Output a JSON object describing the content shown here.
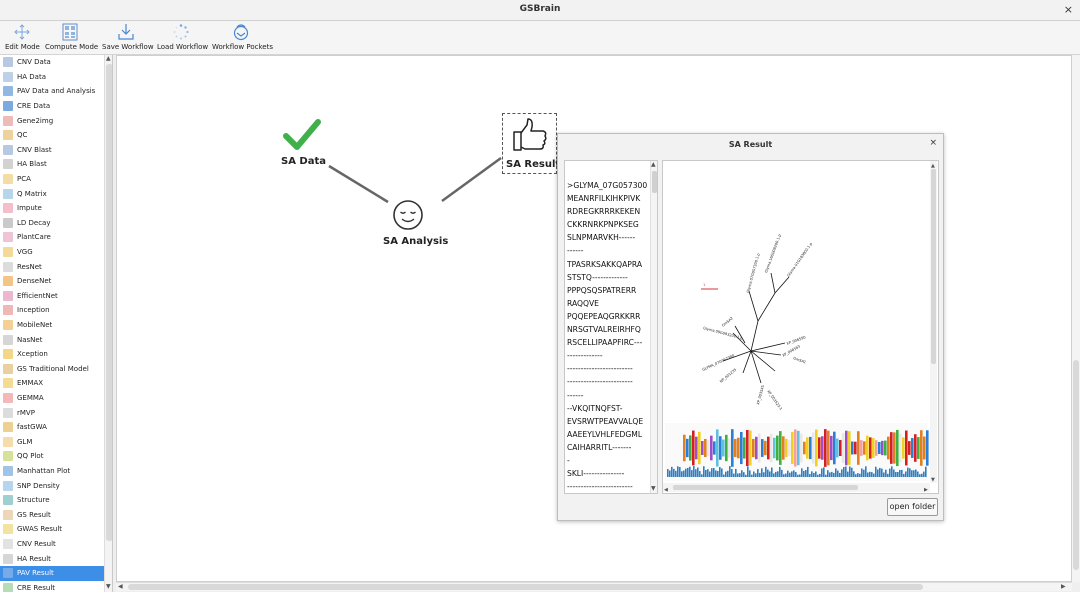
{
  "window": {
    "title": "GSBrain",
    "close": "×"
  },
  "toolbar": {
    "items": [
      {
        "label": "Edit Mode",
        "icon": "move-icon"
      },
      {
        "label": "Compute Mode",
        "icon": "calculator-icon"
      },
      {
        "label": "Save Workflow",
        "icon": "download-icon"
      },
      {
        "label": "Load Workflow",
        "icon": "spinner-icon"
      },
      {
        "label": "Workflow Pockets",
        "icon": "pockets-icon"
      }
    ]
  },
  "sidebar": {
    "selected": "PAV Result",
    "items": [
      {
        "label": "CNV Data",
        "color": "#9fb7d8"
      },
      {
        "label": "HA Data",
        "color": "#a9c2e0"
      },
      {
        "label": "PAV Data and Analysis",
        "color": "#6aa2d8"
      },
      {
        "label": "CRE Data",
        "color": "#4f8fd3"
      },
      {
        "label": "Gene2img",
        "color": "#e9a3a3"
      },
      {
        "label": "QC",
        "color": "#e9c27a"
      },
      {
        "label": "CNV Blast",
        "color": "#9fb7d8"
      },
      {
        "label": "HA Blast",
        "color": "#c3c3c3"
      },
      {
        "label": "PCA",
        "color": "#f0d08a"
      },
      {
        "label": "Q Matrix",
        "color": "#9ec8e6"
      },
      {
        "label": "Impute",
        "color": "#f0a8b8"
      },
      {
        "label": "LD Decay",
        "color": "#b8b8b8"
      },
      {
        "label": "PlantCare",
        "color": "#e8b0c8"
      },
      {
        "label": "VGG",
        "color": "#f2cc7a"
      },
      {
        "label": "ResNet",
        "color": "#d0d0d0"
      },
      {
        "label": "DenseNet",
        "color": "#f0b060"
      },
      {
        "label": "EfficientNet",
        "color": "#e6a0c0"
      },
      {
        "label": "Inception",
        "color": "#e8a0a0"
      },
      {
        "label": "MobileNet",
        "color": "#f0c070"
      },
      {
        "label": "NasNet",
        "color": "#c8c8c8"
      },
      {
        "label": "Xception",
        "color": "#f0c860"
      },
      {
        "label": "GS Traditional Model",
        "color": "#e0c080"
      },
      {
        "label": "EMMAX",
        "color": "#f0d070"
      },
      {
        "label": "GEMMA",
        "color": "#f0a0a0"
      },
      {
        "label": "rMVP",
        "color": "#d0d0d0"
      },
      {
        "label": "fastGWA",
        "color": "#e8c070"
      },
      {
        "label": "GLM",
        "color": "#f0d090"
      },
      {
        "label": "QQ Plot",
        "color": "#c8d878"
      },
      {
        "label": "Manhattan Plot",
        "color": "#7fb0e0"
      },
      {
        "label": "SNP Density",
        "color": "#9fc8e8"
      },
      {
        "label": "Structure",
        "color": "#7fc0c0"
      },
      {
        "label": "GS Result",
        "color": "#e8c8a0"
      },
      {
        "label": "GWAS Result",
        "color": "#f0d880"
      },
      {
        "label": "CNV Result",
        "color": "#d8d8d8"
      },
      {
        "label": "HA Result",
        "color": "#c8c8c8"
      },
      {
        "label": "PAV Result",
        "color": "#8ab4e8"
      },
      {
        "label": "CRE Result",
        "color": "#9fd0a0"
      }
    ]
  },
  "canvas": {
    "nodes": {
      "sa_data": {
        "label": "SA Data",
        "icon": "checkmark-icon"
      },
      "sa_analysis": {
        "label": "SA Analysis",
        "icon": "smiley-face-icon"
      },
      "sa_result": {
        "label": "SA Result",
        "icon": "thumbs-up-icon"
      }
    }
  },
  "dialog": {
    "title": "SA Result",
    "close": "×",
    "sequence_lines": [
      ">GLYMA_07G057300",
      "MEANRFILKIHKPIVK",
      "RDREGKRRRKEKEN",
      "CKKRNRKPNPKSEG",
      "SLNPMARVKH------",
      "------",
      "TPASRKSAKKQAPRA",
      "STSTQ-------------",
      "PPPQSQSPATRERR",
      "RAQQVE",
      "PQQEPEAQGRKKRR",
      "NRSGTVALREIRHFQ",
      "RSCELLIPAAPFIRC---",
      "-------------",
      "------------------------",
      "------------------------",
      "------",
      "--VKQITNQFST-",
      "EVSRWTPEAVVALQE",
      "AAEEYLVHLFEDGML",
      "CAIHARRITL-------",
      "-",
      "SKLI---------------",
      "------------------------",
      "-------"
    ],
    "open_button": "open folder"
  }
}
